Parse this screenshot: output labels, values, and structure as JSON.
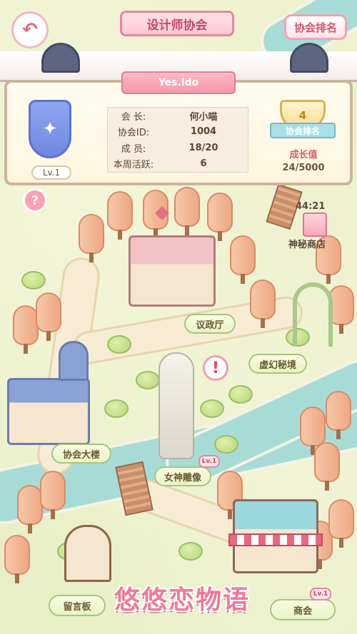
{
  "header": {
    "back_icon": "back-arrow-icon",
    "title": "设计师协会",
    "rank_button": "协会排名"
  },
  "guild": {
    "name": "Yes.ldo",
    "level": "Lv.1",
    "emblem_icon": "wing-emblem-icon",
    "rows": [
      {
        "key": "会  长:",
        "value": "何小喵"
      },
      {
        "key": "协会ID:",
        "value": "1004"
      },
      {
        "key": "成  员:",
        "value": "18/20"
      },
      {
        "key": "本周活跃:",
        "value": "6"
      }
    ],
    "rank_number": "4",
    "rank_label": "协会排名",
    "growth_label": "成长值",
    "growth_value": "24/5000"
  },
  "help_icon": "question-icon",
  "map": {
    "shop_timer": "44:21",
    "mystery_shop": "神秘商店",
    "hall": "议政厅",
    "dream": "虚幻秘境",
    "guild_tower": "协会大楼",
    "goddess": "女神雕像",
    "goddess_level": "Lv.1",
    "message_board": "留言板",
    "store": "商会",
    "store_level": "Lv.1",
    "alert_icon": "exclamation-icon"
  },
  "logo": "悠悠恋物语",
  "colors": {
    "accent": "#e8869b",
    "sign_green": "#a8c47d",
    "river": "#a7dcd6"
  }
}
